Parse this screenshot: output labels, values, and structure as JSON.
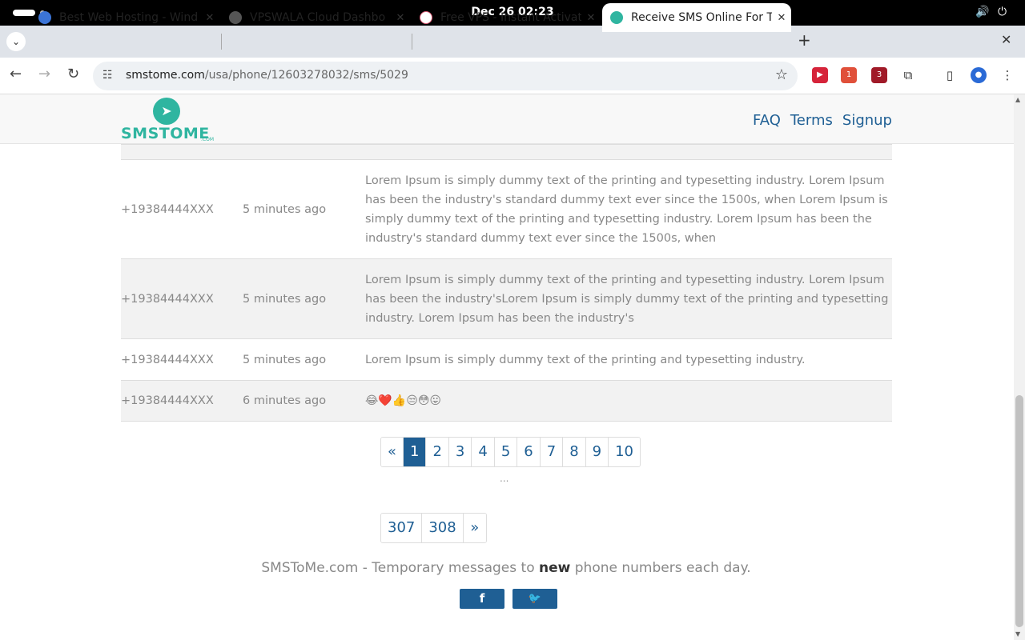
{
  "os": {
    "clock": "Dec 26  02:23"
  },
  "browser": {
    "tabs": [
      {
        "title": "Best Web Hosting - Wind",
        "icon": "cloud-icon",
        "color": "#3b74d6"
      },
      {
        "title": "VPSWALA Cloud Dashbo",
        "icon": "globe-icon",
        "color": "#555555"
      },
      {
        "title": "Free VPS - Instant Activat",
        "icon": "cloud-outline-icon",
        "color": "#e0607a"
      },
      {
        "title": "Receive SMS Online For T",
        "icon": "paper-plane-icon",
        "color": "#2fb5a0"
      }
    ],
    "url_host": "smstome.com",
    "url_path": "/usa/phone/12603278032/sms/5029"
  },
  "site": {
    "logo_text": "SMSTOME",
    "logo_sub": ".COM",
    "nav": [
      "FAQ",
      "Terms",
      "Signup"
    ]
  },
  "messages": [
    {
      "number": "+19384444XXX",
      "time": "5 minutes ago",
      "text": "Lorem Ipsum is simply dummy text of the printing and typesetting industry. Lorem Ipsum has been the industry's standard dummy text ever since the 1500s, when Lorem Ipsum is simply dummy text of the printing and typesetting industry. Lorem Ipsum has been the industry's standard dummy text ever since the 1500s, when"
    },
    {
      "number": "+19384444XXX",
      "time": "5 minutes ago",
      "text": "Lorem Ipsum is simply dummy text of the printing and typesetting industry. Lorem Ipsum has been the industry'sLorem Ipsum is simply dummy text of the printing and typesetting industry. Lorem Ipsum has been the industry's"
    },
    {
      "number": "+19384444XXX",
      "time": "5 minutes ago",
      "text": "Lorem Ipsum is simply dummy text of the printing and typesetting industry."
    },
    {
      "number": "+19384444XXX",
      "time": "6 minutes ago",
      "text": "😂❤️👍😒😳😛"
    }
  ],
  "pagination": {
    "prev": "«",
    "pages": [
      "1",
      "2",
      "3",
      "4",
      "5",
      "6",
      "7",
      "8",
      "9",
      "10"
    ],
    "active": "1",
    "ellipsis": "...",
    "last_pages": [
      "307",
      "308"
    ],
    "next": "»"
  },
  "footer": {
    "text_before": "SMSToMe.com - Temporary messages to ",
    "text_bold": "new",
    "text_after": " phone numbers each day.",
    "facebook": "f",
    "twitter": "🐦"
  }
}
